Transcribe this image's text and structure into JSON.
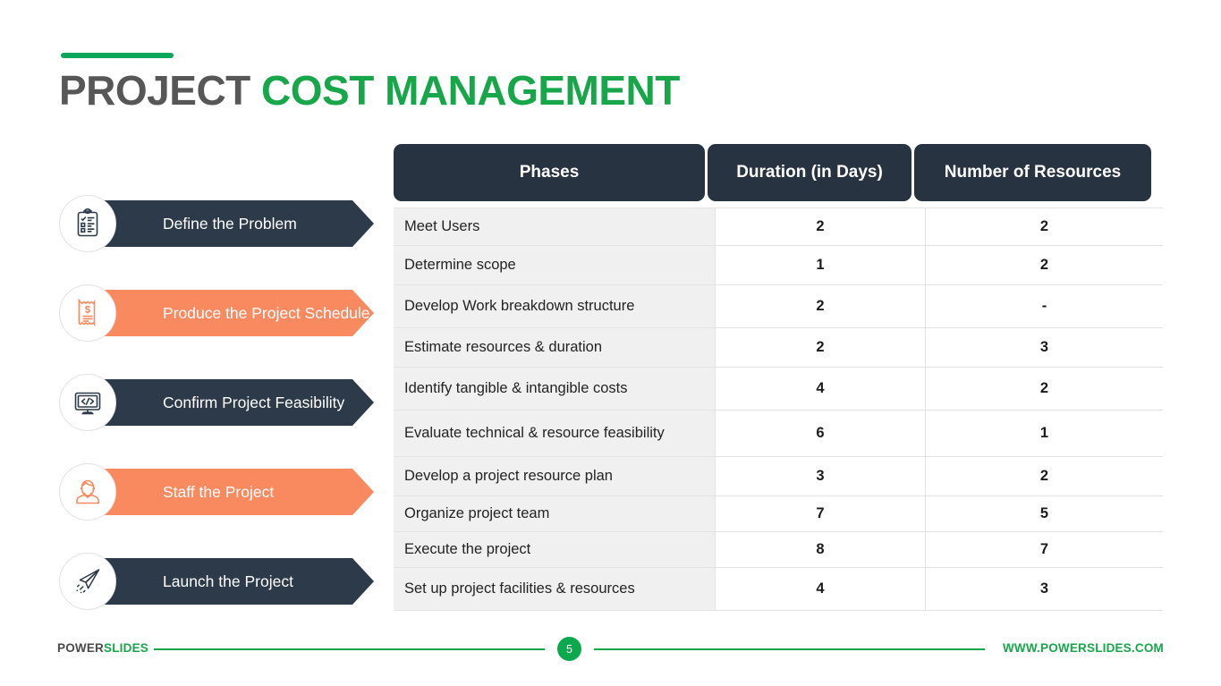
{
  "title": {
    "part1": "PROJECT",
    "part2": "COST MANAGEMENT"
  },
  "colors": {
    "green": "#17a74a",
    "dark_navy": "#2c3a49",
    "orange": "#f9895f",
    "header_navy": "#283342",
    "row_gray": "#f0f0f0",
    "title_gray": "#575757"
  },
  "steps": [
    {
      "label": "Define the Problem",
      "icon": "clipboard-checklist-icon",
      "style": "dark"
    },
    {
      "label": "Produce the Project Schedule",
      "icon": "receipt-dollar-icon",
      "style": "orange"
    },
    {
      "label": "Confirm Project Feasibility",
      "icon": "monitor-code-icon",
      "style": "dark"
    },
    {
      "label": "Staff the Project",
      "icon": "person-user-icon",
      "style": "orange"
    },
    {
      "label": "Launch the Project",
      "icon": "paper-plane-icon",
      "style": "dark"
    }
  ],
  "table": {
    "columns": [
      "Phases",
      "Duration (in Days)",
      "Number of Resources"
    ],
    "rows": [
      {
        "phase": "Meet Users",
        "duration": "2",
        "resources": "2"
      },
      {
        "phase": "Determine scope",
        "duration": "1",
        "resources": "2"
      },
      {
        "phase": "Develop Work breakdown structure",
        "duration": "2",
        "resources": "-"
      },
      {
        "phase": "Estimate resources & duration",
        "duration": "2",
        "resources": "3"
      },
      {
        "phase": "Identify tangible & intangible costs",
        "duration": "4",
        "resources": "2"
      },
      {
        "phase": "Evaluate technical & resource feasibility",
        "duration": "6",
        "resources": "1"
      },
      {
        "phase": "Develop a project resource plan",
        "duration": "3",
        "resources": "2"
      },
      {
        "phase": "Organize project team",
        "duration": "7",
        "resources": "5"
      },
      {
        "phase": "Execute the project",
        "duration": "8",
        "resources": "7"
      },
      {
        "phase": "Set up project facilities & resources",
        "duration": "4",
        "resources": "3"
      }
    ]
  },
  "footer": {
    "brand_part1": "POWER",
    "brand_part2": "SLIDES",
    "page_number": "5",
    "website": "WWW.POWERSLIDES.COM"
  }
}
